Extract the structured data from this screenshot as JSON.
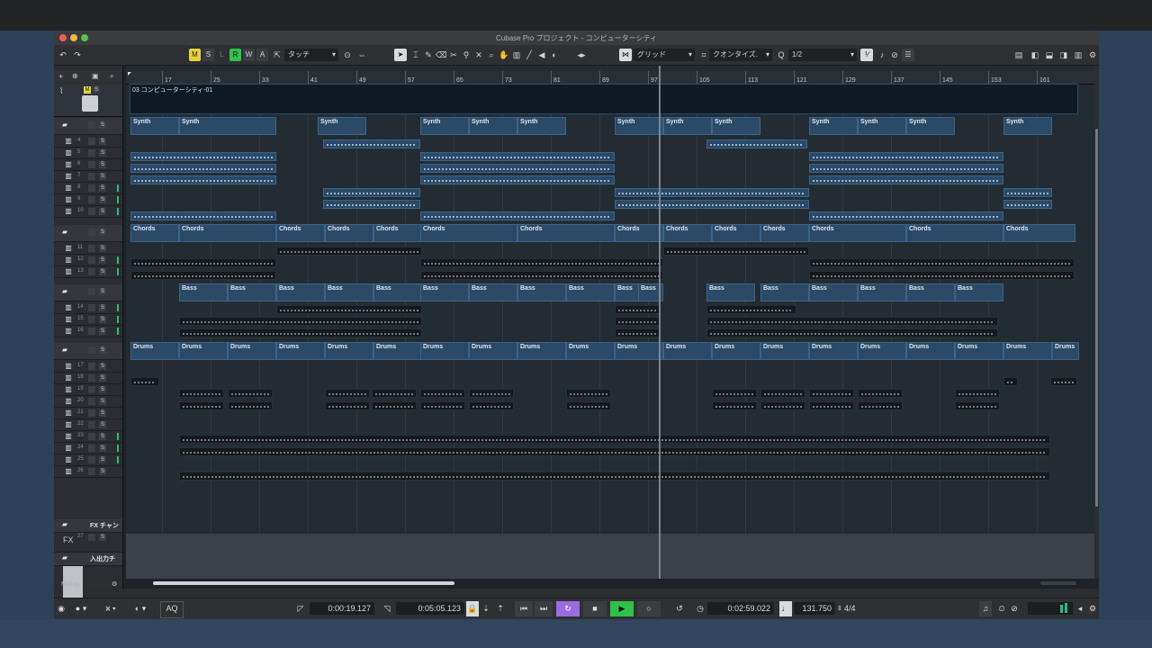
{
  "window": {
    "title": "Cubase Pro プロジェクト - コンピューターシティ"
  },
  "toolbar": {
    "status_buttons": [
      "M",
      "S",
      "L",
      "R",
      "W",
      "A"
    ],
    "automation_mode": "タッチ",
    "snap_type": "グリッド",
    "quantize_label": "クオンタイズ.",
    "quantize_value": "1/2"
  },
  "ruler": {
    "bars": [
      "17",
      "25",
      "33",
      "41",
      "49",
      "57",
      "65",
      "73",
      "81",
      "89",
      "97",
      "105",
      "113",
      "121",
      "129",
      "137",
      "145",
      "153",
      "161"
    ]
  },
  "tracks": {
    "audio_track_name": "03 コンピューターシティ-01",
    "folder_names": [
      "Synth",
      "Chords",
      "Bass",
      "Drums"
    ],
    "fx_label": "FX チャン",
    "io_label": "入出力チ",
    "fx_tag": "FX",
    "track_numbers": [
      "4",
      "5",
      "6",
      "7",
      "8",
      "9",
      "10",
      "11",
      "12",
      "13",
      "14",
      "15",
      "16",
      "17",
      "18",
      "19",
      "20",
      "21",
      "22",
      "23",
      "24",
      "25",
      "26",
      "27"
    ]
  },
  "bottom": {
    "zone_label": "Mixing"
  },
  "transport": {
    "left_locator": "0:00:19.127",
    "right_locator": "0:05:05.123",
    "position": "0:02:59.022",
    "tempo": "131.750",
    "signature": "4/4",
    "aq_label": "AQ"
  },
  "colors": {
    "part_blue": "#2a4a68",
    "record_green": "#25c07a",
    "play_green": "#2ec24a",
    "monitor_yellow": "#e8d23a",
    "cycle_purple": "#9b6be0"
  }
}
